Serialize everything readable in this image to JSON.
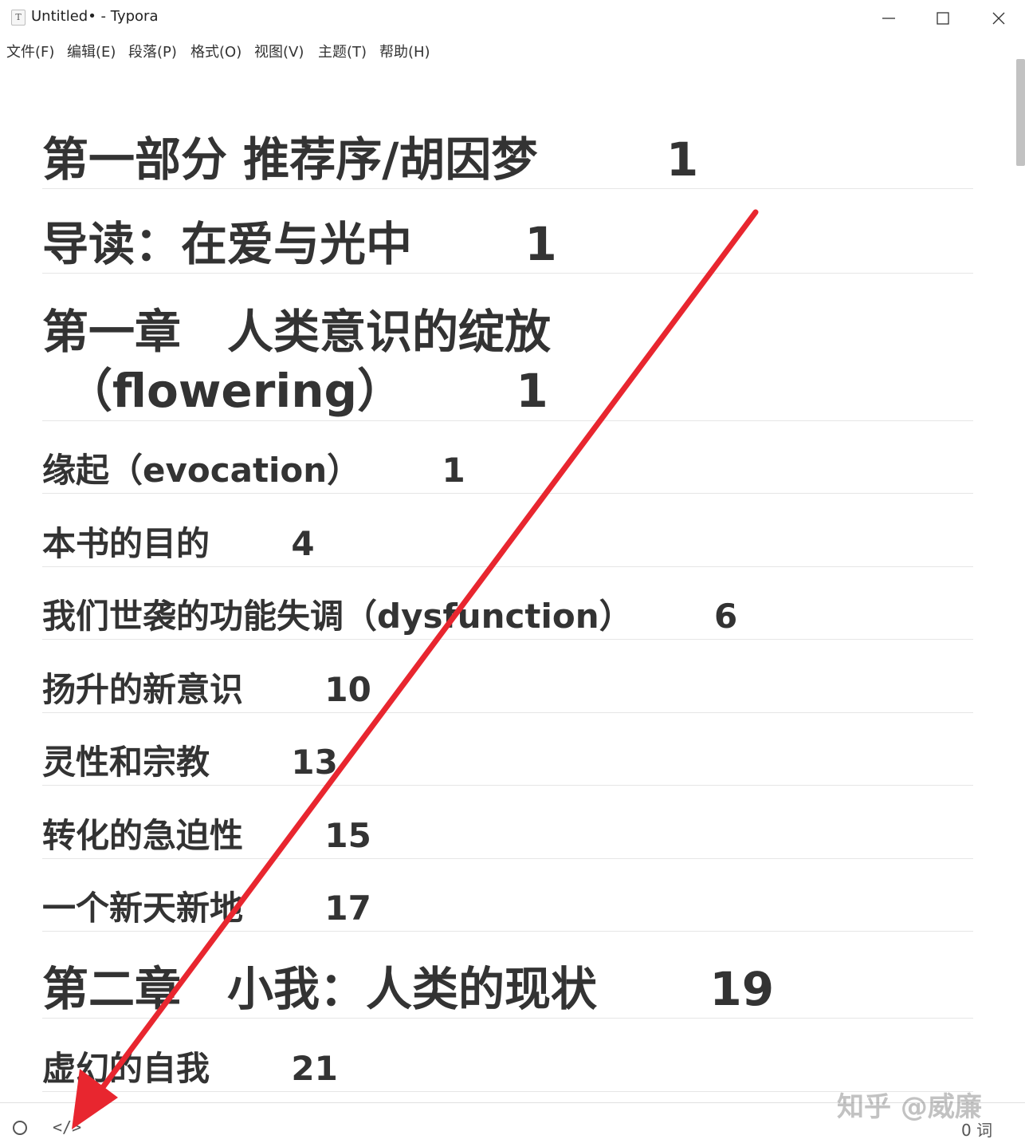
{
  "window": {
    "app_icon_glyph": "T",
    "title": "Untitled• - Typora"
  },
  "menu": [
    {
      "label": "文件(F)"
    },
    {
      "label": "编辑(E)"
    },
    {
      "label": "段落(P)"
    },
    {
      "label": "格式(O)"
    },
    {
      "label": "视图(V)"
    },
    {
      "label": "主题(T)"
    },
    {
      "label": "帮助(H)"
    }
  ],
  "document": {
    "headings": [
      {
        "level": 1,
        "text": "第一部分 推荐序/胡因梦        1"
      },
      {
        "level": 1,
        "text": "导读：在爱与光中       1"
      },
      {
        "level": 1,
        "text": "第一章　人类意识的绽放"
      },
      {
        "level": 1,
        "text": "（flowering）       1"
      },
      {
        "level": 2,
        "text": "缘起（evocation）       1"
      },
      {
        "level": 2,
        "text": "本书的目的       4"
      },
      {
        "level": 2,
        "text": "我们世袭的功能失调（dysfunction）       6"
      },
      {
        "level": 2,
        "text": "扬升的新意识       10"
      },
      {
        "level": 2,
        "text": "灵性和宗教       13"
      },
      {
        "level": 2,
        "text": "转化的急迫性       15"
      },
      {
        "level": 2,
        "text": "一个新天新地       17"
      },
      {
        "level": 1,
        "text": "第二章　小我：人类的现状       19"
      },
      {
        "level": 2,
        "text": "虚幻的自我       21"
      }
    ]
  },
  "statusbar": {
    "word_count": "0 词"
  },
  "watermark": "知乎 @威廉",
  "colors": {
    "annotation_arrow": "#e8262f",
    "heading_text": "#333333"
  }
}
